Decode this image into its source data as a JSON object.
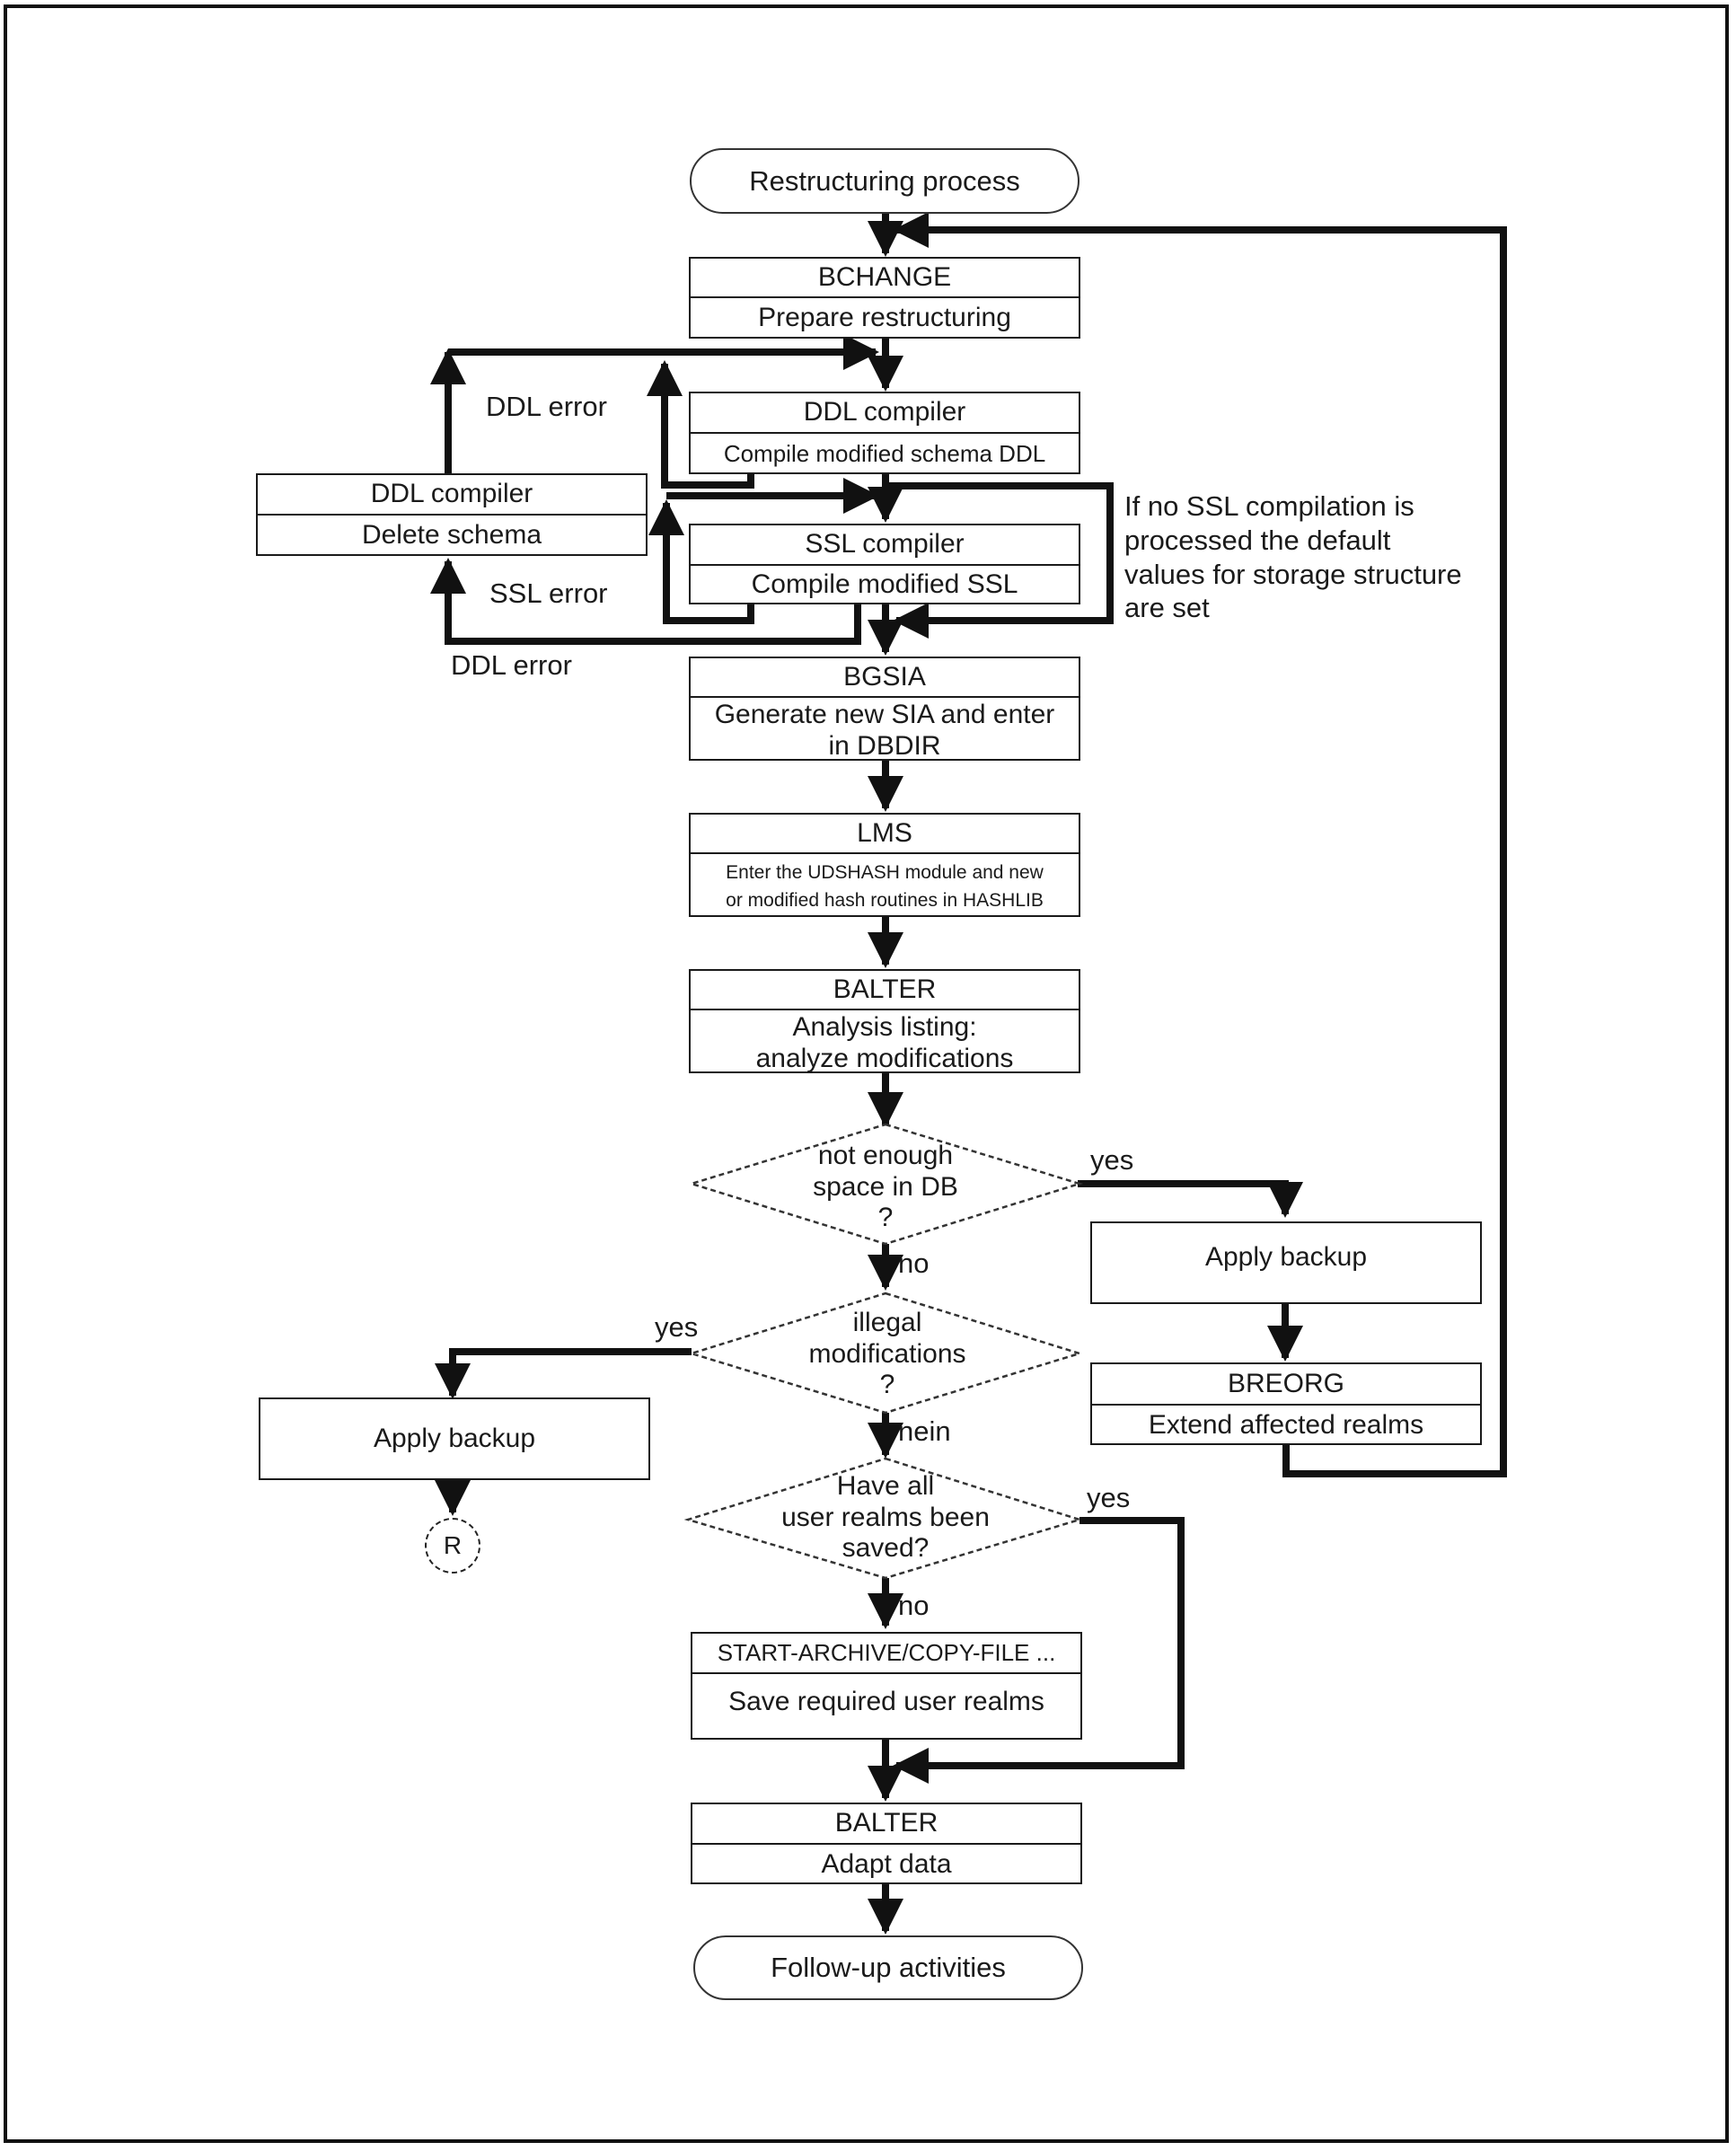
{
  "diagram": {
    "start": "Restructuring process",
    "end": "Follow-up activities",
    "steps": {
      "bchange": {
        "title": "BCHANGE",
        "desc": "Prepare restructuring"
      },
      "ddl_compile": {
        "title": "DDL compiler",
        "desc": "Compile modified schema DDL"
      },
      "ddl_delete": {
        "title": "DDL compiler",
        "desc": "Delete schema"
      },
      "ssl_compile": {
        "title": "SSL compiler",
        "desc": "Compile modified SSL"
      },
      "bgsia": {
        "title": "BGSIA",
        "desc_line1": "Generate new SIA and enter",
        "desc_line2": "in DBDIR"
      },
      "lms": {
        "title": "LMS",
        "desc_line1": "Enter the UDSHASH module and new",
        "desc_line2": "or modified hash routines in HASHLIB"
      },
      "balter_analysis": {
        "title": "BALTER",
        "desc_line1": "Analysis listing:",
        "desc_line2": "analyze modifications"
      },
      "apply_backup_right": {
        "desc": "Apply backup"
      },
      "breorg": {
        "title": "BREORG",
        "desc": "Extend affected realms"
      },
      "apply_backup_left": {
        "desc": "Apply backup"
      },
      "archive": {
        "title": "START-ARCHIVE/COPY-FILE ...",
        "desc": "Save required user realms"
      },
      "balter_adapt": {
        "title": "BALTER",
        "desc": "Adapt data"
      }
    },
    "decisions": {
      "space": {
        "line1": "not enough",
        "line2": "space in DB",
        "line3": "?"
      },
      "illegal": {
        "line1": "illegal",
        "line2": "modifications",
        "line3": "?"
      },
      "saved": {
        "line1": "Have all",
        "line2": "user realms been",
        "line3": "saved?"
      }
    },
    "labels": {
      "ddl_error_top": "DDL error",
      "ssl_error": "SSL error",
      "ddl_error_bottom": "DDL error",
      "space_yes": "yes",
      "space_no": "no",
      "illegal_yes": "yes",
      "illegal_no": "nein",
      "saved_yes": "yes",
      "saved_no": "no"
    },
    "note": {
      "line1": "If no SSL compilation is",
      "line2": "processed the default",
      "line3": "values for storage structure",
      "line4": "are set"
    },
    "connector": "R"
  }
}
